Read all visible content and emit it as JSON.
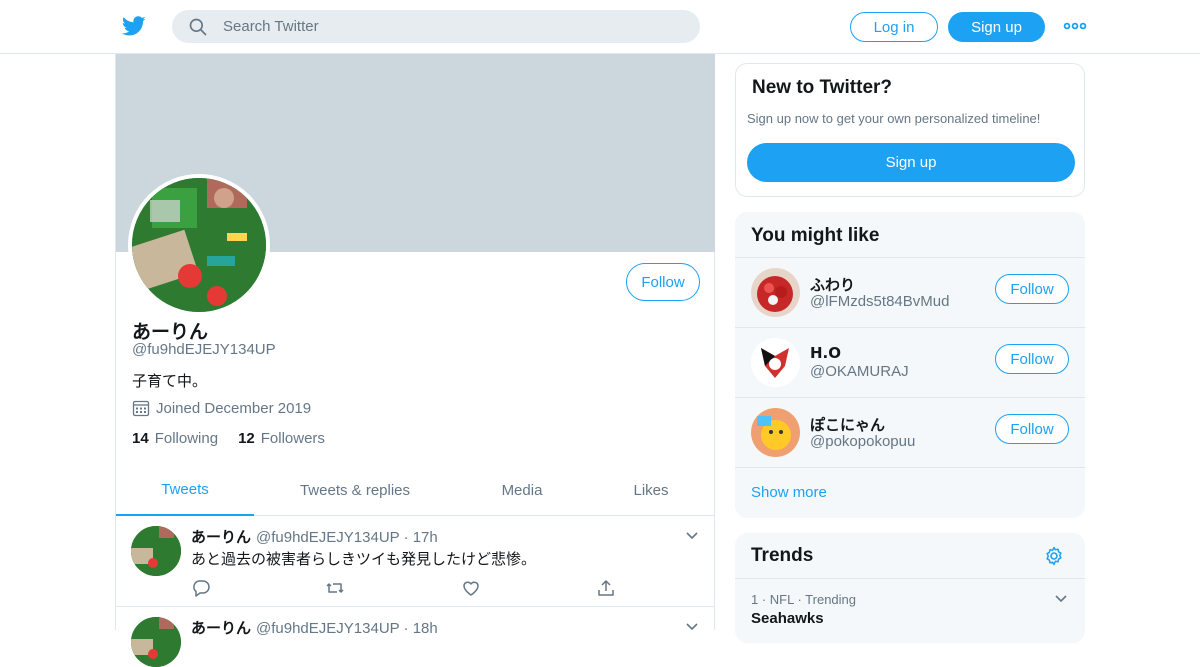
{
  "colors": {
    "accent": "#1da1f2",
    "muted": "#657786",
    "border": "#e1e8ed",
    "banner": "#ccd6dd",
    "panel": "#f5f8fa"
  },
  "topbar": {
    "logo_icon": "twitter-bird-icon",
    "search_placeholder": "Search Twitter",
    "login_label": "Log in",
    "signup_label": "Sign up",
    "more_icon": "more-dots-icon"
  },
  "profile": {
    "name": "あーりん",
    "handle": "@fu9hdEJEJY134UP",
    "bio": "子育て中。",
    "joined": "Joined December 2019",
    "following_count": "14",
    "following_label": "Following",
    "followers_count": "12",
    "followers_label": "Followers",
    "follow_label": "Follow"
  },
  "tabs": [
    {
      "label": "Tweets",
      "active": true
    },
    {
      "label": "Tweets & replies",
      "active": false
    },
    {
      "label": "Media",
      "active": false
    },
    {
      "label": "Likes",
      "active": false
    }
  ],
  "tweets": [
    {
      "name": "あーりん",
      "meta": "@fu9hdEJEJY134UP · 17h",
      "text": "あと過去の被害者らしきツイも発見したけど悲惨。"
    },
    {
      "name": "あーりん",
      "meta": "@fu9hdEJEJY134UP · 18h",
      "text": ""
    }
  ],
  "new_to_twitter": {
    "title": "New to Twitter?",
    "subtitle": "Sign up now to get your own personalized timeline!",
    "button": "Sign up"
  },
  "you_might_like": {
    "title": "You might like",
    "users": [
      {
        "name": "ふわり",
        "handle": "@lFMzds5t84BvMud",
        "follow": "Follow"
      },
      {
        "name": "H.O",
        "handle": "@OKAMURAJ",
        "follow": "Follow"
      },
      {
        "name": "ぽこにゃん",
        "handle": "@pokopokopuu",
        "follow": "Follow"
      }
    ],
    "show_more": "Show more"
  },
  "trends": {
    "title": "Trends",
    "items": [
      {
        "context": "1 · NFL · Trending",
        "topic": "Seahawks"
      }
    ]
  }
}
